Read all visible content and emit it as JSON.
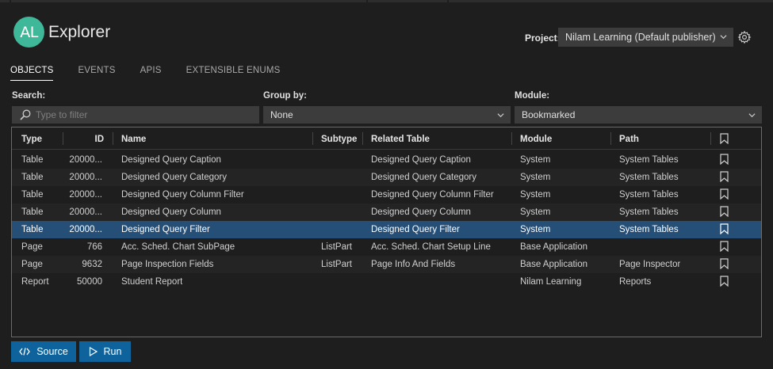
{
  "app": {
    "logo_text": "AL",
    "title": "Explorer",
    "accent": "#3fb89a"
  },
  "project": {
    "label": "Project:",
    "value": "Nilam Learning (Default publisher)"
  },
  "tabs": [
    {
      "label": "OBJECTS",
      "active": true
    },
    {
      "label": "EVENTS",
      "active": false
    },
    {
      "label": "APIS",
      "active": false
    },
    {
      "label": "EXTENSIBLE ENUMS",
      "active": false
    }
  ],
  "filters": {
    "search_label": "Search:",
    "search_placeholder": "Type to filter",
    "group_label": "Group by:",
    "group_value": "None",
    "module_label": "Module:",
    "module_value": "Bookmarked"
  },
  "table": {
    "columns": [
      "Type",
      "ID",
      "Name",
      "Subtype",
      "Related Table",
      "Module",
      "Path"
    ],
    "rows": [
      {
        "type": "Table",
        "id": "20000...",
        "name": "Designed Query Caption",
        "subtype": "",
        "related": "Designed Query Caption",
        "module": "System",
        "path": "System Tables"
      },
      {
        "type": "Table",
        "id": "20000...",
        "name": "Designed Query Category",
        "subtype": "",
        "related": "Designed Query Category",
        "module": "System",
        "path": "System Tables"
      },
      {
        "type": "Table",
        "id": "20000...",
        "name": "Designed Query Column Filter",
        "subtype": "",
        "related": "Designed Query Column Filter",
        "module": "System",
        "path": "System Tables"
      },
      {
        "type": "Table",
        "id": "20000...",
        "name": "Designed Query Column",
        "subtype": "",
        "related": "Designed Query Column",
        "module": "System",
        "path": "System Tables"
      },
      {
        "type": "Table",
        "id": "20000...",
        "name": "Designed Query Filter",
        "subtype": "",
        "related": "Designed Query Filter",
        "module": "System",
        "path": "System Tables",
        "selected": true
      },
      {
        "type": "Page",
        "id": "766",
        "name": "Acc. Sched. Chart SubPage",
        "subtype": "ListPart",
        "related": "Acc. Sched. Chart Setup Line",
        "module": "Base Application",
        "path": ""
      },
      {
        "type": "Page",
        "id": "9632",
        "name": "Page Inspection Fields",
        "subtype": "ListPart",
        "related": "Page Info And Fields",
        "module": "Base Application",
        "path": "Page Inspector"
      },
      {
        "type": "Report",
        "id": "50000",
        "name": "Student Report",
        "subtype": "",
        "related": "",
        "module": "Nilam Learning",
        "path": "Reports"
      }
    ]
  },
  "buttons": {
    "source": "Source",
    "run": "Run"
  },
  "colors": {
    "background": "#1e1e1e",
    "input": "#3c3c3c",
    "selected_row": "#264f78",
    "button": "#0e639c"
  }
}
